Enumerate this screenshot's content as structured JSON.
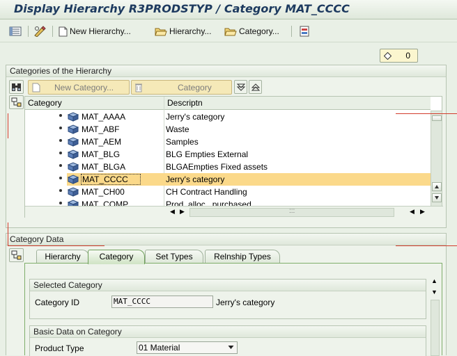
{
  "window_title": "Display Hierarchy R3PRODSTYP / Category MAT_CCCC",
  "toolbar": {
    "new_hierarchy": "New Hierarchy...",
    "hierarchy": "Hierarchy...",
    "category": "Category..."
  },
  "counter": {
    "value": "0"
  },
  "categories_group": {
    "title": "Categories of the Hierarchy",
    "new_category_button": "New Category...",
    "category_button": "Category",
    "columns": {
      "category": "Category",
      "description": "Descriptn"
    },
    "rows": [
      {
        "category": "MAT_AAAA",
        "description": "Jerry's category",
        "selected": false
      },
      {
        "category": "MAT_ABF",
        "description": "Waste",
        "selected": false
      },
      {
        "category": "MAT_AEM",
        "description": "Samples",
        "selected": false
      },
      {
        "category": "MAT_BLG",
        "description": "BLG Empties  External",
        "selected": false
      },
      {
        "category": "MAT_BLGA",
        "description": "BLGAEmpties  Fixed assets",
        "selected": false
      },
      {
        "category": "MAT_CCCC",
        "description": "Jerry's category",
        "selected": true
      },
      {
        "category": "MAT_CH00",
        "description": "CH Contract Handling",
        "selected": false
      },
      {
        "category": "MAT_COMP",
        "description": "Prod. alloc., purchased",
        "selected": false
      }
    ],
    "hscroll_grip": ":::"
  },
  "category_data": {
    "title": "Category Data",
    "tabs": [
      {
        "label": "Hierarchy",
        "active": false
      },
      {
        "label": "Category",
        "active": true
      },
      {
        "label": "Set Types",
        "active": false
      },
      {
        "label": "Relnship Types",
        "active": false
      }
    ],
    "selected_category": {
      "title": "Selected Category",
      "category_id_label": "Category ID",
      "category_id_value": "MAT_CCCC",
      "category_description": "Jerry's category"
    },
    "basic_data": {
      "title": "Basic Data on Category",
      "product_type_label": "Product Type",
      "product_type_value": "01 Material"
    }
  },
  "colors": {
    "background": "#e9f0e6",
    "title_text": "#1d3a5f",
    "selected_row": "#fbd98a",
    "counter_bg": "#fbf6cf",
    "annotation_red": "#d23b2b"
  }
}
